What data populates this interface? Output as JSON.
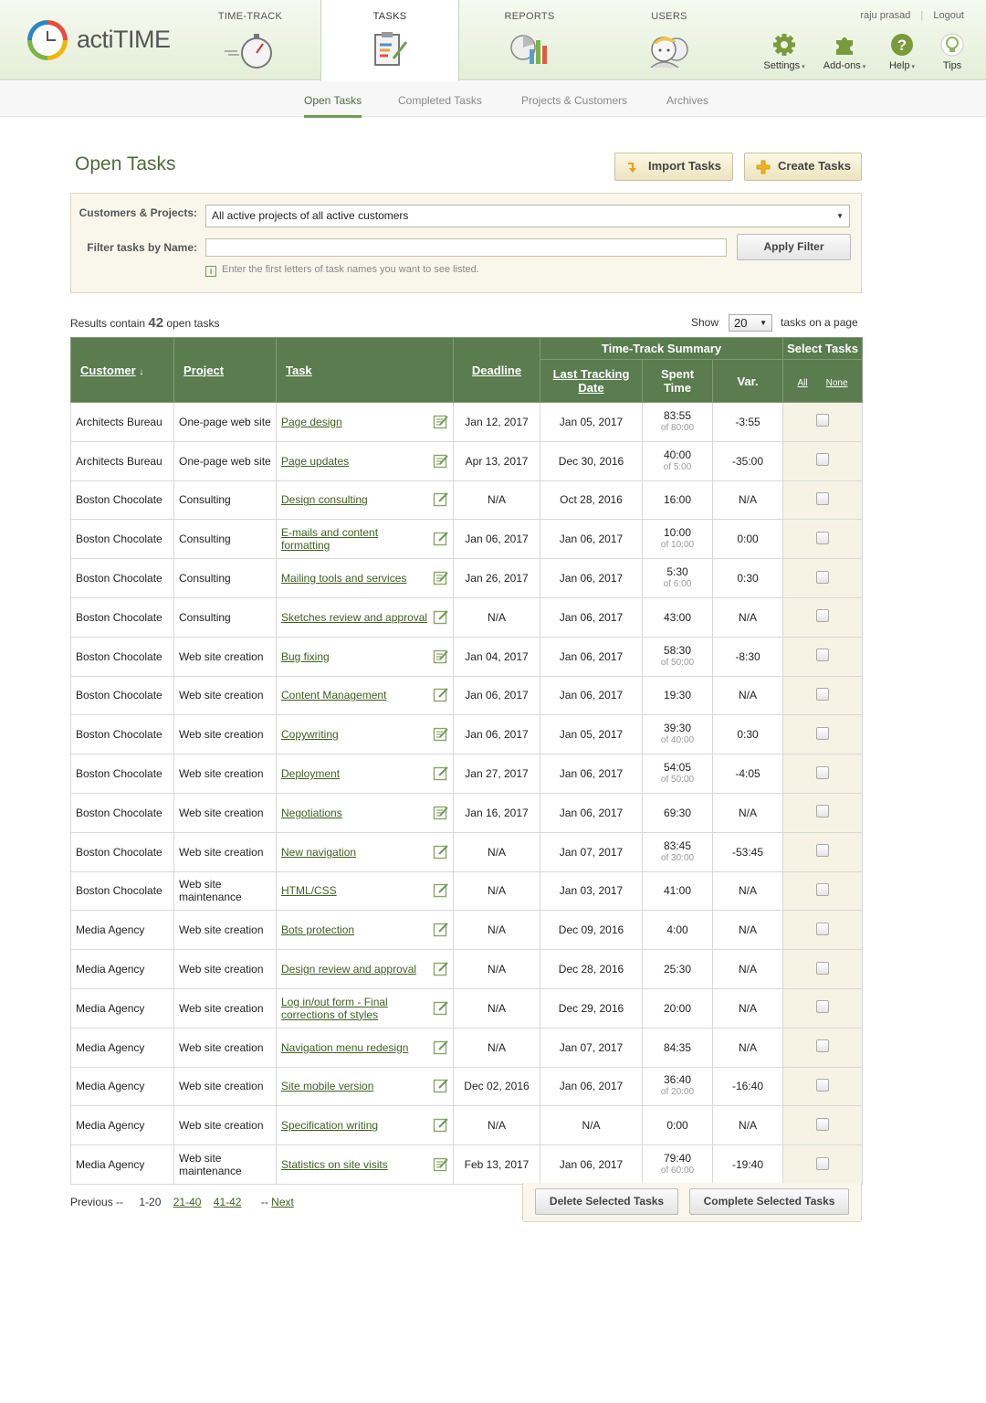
{
  "app": {
    "brand": "actiTIME"
  },
  "nav": {
    "tabs": [
      {
        "label": "TIME-TRACK"
      },
      {
        "label": "TASKS"
      },
      {
        "label": "REPORTS"
      },
      {
        "label": "USERS"
      }
    ],
    "user_name": "raju prasad",
    "logout": "Logout",
    "tools": [
      {
        "label": "Settings",
        "icon": "gear-icon"
      },
      {
        "label": "Add-ons",
        "icon": "puzzle-icon"
      },
      {
        "label": "Help",
        "icon": "help-icon"
      },
      {
        "label": "Tips",
        "icon": "lightbulb-icon"
      }
    ]
  },
  "subnav": {
    "tabs": [
      {
        "label": "Open Tasks",
        "active": true
      },
      {
        "label": "Completed Tasks"
      },
      {
        "label": "Projects & Customers"
      },
      {
        "label": "Archives"
      }
    ]
  },
  "page": {
    "title": "Open Tasks",
    "import_label": "Import Tasks",
    "create_label": "Create Tasks"
  },
  "filter": {
    "customers_label": "Customers & Projects:",
    "customers_value": "All active projects of all active customers",
    "name_label": "Filter tasks by Name:",
    "name_value": "",
    "apply_label": "Apply Filter",
    "hint": "Enter the first letters of task names you want to see listed."
  },
  "results": {
    "prefix": "Results contain",
    "count": "42",
    "suffix": "open tasks",
    "show_label": "Show",
    "page_size": "20",
    "page_suffix": "tasks on a page"
  },
  "table": {
    "headers": {
      "customer": "Customer",
      "project": "Project",
      "task": "Task",
      "deadline": "Deadline",
      "summary": "Time-Track Summary",
      "last_tracking": "Last Tracking Date",
      "spent": "Spent Time",
      "var": "Var.",
      "select": "Select Tasks",
      "all": "All",
      "none": "None"
    },
    "rows": [
      {
        "customer": "Architects Bureau",
        "project": "One-page web site",
        "task": "Page design",
        "deadline": "Jan 12, 2017",
        "deadline_red": false,
        "last": "Jan 05, 2017",
        "spent": "83:55",
        "of": "of 80:00",
        "var": "-3:55",
        "var_style": "red",
        "icon": "notes"
      },
      {
        "customer": "Architects Bureau",
        "project": "One-page web site",
        "task": "Page updates",
        "deadline": "Apr 13, 2017",
        "deadline_red": false,
        "last": "Dec 30, 2016",
        "spent": "40:00",
        "of": "of 5:00",
        "var": "-35:00",
        "var_style": "red",
        "icon": "notes"
      },
      {
        "customer": "Boston Chocolate",
        "project": "Consulting",
        "task": "Design consulting",
        "deadline": "N/A",
        "deadline_red": false,
        "last": "Oct 28, 2016",
        "spent": "16:00",
        "of": "",
        "var": "N/A",
        "var_style": "",
        "icon": "edit"
      },
      {
        "customer": "Boston Chocolate",
        "project": "Consulting",
        "task": "E-mails and content formatting",
        "deadline": "Jan 06, 2017",
        "deadline_red": true,
        "last": "Jan 06, 2017",
        "spent": "10:00",
        "of": "of 10:00",
        "var": "0:00",
        "var_style": "grey",
        "icon": "edit"
      },
      {
        "customer": "Boston Chocolate",
        "project": "Consulting",
        "task": "Mailing tools and services",
        "deadline": "Jan 26, 2017",
        "deadline_red": false,
        "last": "Jan 06, 2017",
        "spent": "5:30",
        "of": "of 6:00",
        "var": "0:30",
        "var_style": "",
        "icon": "notes"
      },
      {
        "customer": "Boston Chocolate",
        "project": "Consulting",
        "task": "Sketches review and approval",
        "deadline": "N/A",
        "deadline_red": false,
        "last": "Jan 06, 2017",
        "spent": "43:00",
        "of": "",
        "var": "N/A",
        "var_style": "",
        "icon": "edit"
      },
      {
        "customer": "Boston Chocolate",
        "project": "Web site creation",
        "task": "Bug fixing",
        "deadline": "Jan 04, 2017",
        "deadline_red": true,
        "last": "Jan 06, 2017",
        "spent": "58:30",
        "of": "of 50:00",
        "var": "-8:30",
        "var_style": "red",
        "icon": "notes"
      },
      {
        "customer": "Boston Chocolate",
        "project": "Web site creation",
        "task": "Content Management",
        "deadline": "Jan 06, 2017",
        "deadline_red": true,
        "last": "Jan 06, 2017",
        "spent": "19:30",
        "of": "",
        "var": "N/A",
        "var_style": "",
        "icon": "edit"
      },
      {
        "customer": "Boston Chocolate",
        "project": "Web site creation",
        "task": "Copywriting",
        "deadline": "Jan 06, 2017",
        "deadline_red": true,
        "last": "Jan 05, 2017",
        "spent": "39:30",
        "of": "of 40:00",
        "var": "0:30",
        "var_style": "",
        "icon": "notes"
      },
      {
        "customer": "Boston Chocolate",
        "project": "Web site creation",
        "task": "Deployment",
        "deadline": "Jan 27, 2017",
        "deadline_red": false,
        "last": "Jan 06, 2017",
        "spent": "54:05",
        "of": "of 50:00",
        "var": "-4:05",
        "var_style": "red",
        "icon": "edit"
      },
      {
        "customer": "Boston Chocolate",
        "project": "Web site creation",
        "task": "Negotiations",
        "deadline": "Jan 16, 2017",
        "deadline_red": false,
        "last": "Jan 06, 2017",
        "spent": "69:30",
        "of": "",
        "var": "N/A",
        "var_style": "",
        "icon": "notes"
      },
      {
        "customer": "Boston Chocolate",
        "project": "Web site creation",
        "task": "New navigation",
        "deadline": "N/A",
        "deadline_red": false,
        "last": "Jan 07, 2017",
        "spent": "83:45",
        "of": "of 30:00",
        "var": "-53:45",
        "var_style": "red",
        "icon": "edit"
      },
      {
        "customer": "Boston Chocolate",
        "project": "Web site maintenance",
        "task": "HTML/CSS",
        "deadline": "N/A",
        "deadline_red": false,
        "last": "Jan 03, 2017",
        "spent": "41:00",
        "of": "",
        "var": "N/A",
        "var_style": "",
        "icon": "edit"
      },
      {
        "customer": "Media Agency",
        "project": "Web site creation",
        "task": "Bots protection",
        "deadline": "N/A",
        "deadline_red": false,
        "last": "Dec 09, 2016",
        "spent": "4:00",
        "of": "",
        "var": "N/A",
        "var_style": "",
        "icon": "edit"
      },
      {
        "customer": "Media Agency",
        "project": "Web site creation",
        "task": "Design review and approval",
        "deadline": "N/A",
        "deadline_red": false,
        "last": "Dec 28, 2016",
        "spent": "25:30",
        "of": "",
        "var": "N/A",
        "var_style": "",
        "icon": "edit"
      },
      {
        "customer": "Media Agency",
        "project": "Web site creation",
        "task": "Log in/out form - Final corrections of styles",
        "deadline": "N/A",
        "deadline_red": false,
        "last": "Dec 29, 2016",
        "spent": "20:00",
        "of": "",
        "var": "N/A",
        "var_style": "",
        "icon": "edit"
      },
      {
        "customer": "Media Agency",
        "project": "Web site creation",
        "task": "Navigation menu redesign",
        "deadline": "N/A",
        "deadline_red": false,
        "last": "Jan 07, 2017",
        "spent": "84:35",
        "of": "",
        "var": "N/A",
        "var_style": "",
        "icon": "edit"
      },
      {
        "customer": "Media Agency",
        "project": "Web site creation",
        "task": "Site mobile version",
        "deadline": "Dec 02, 2016",
        "deadline_red": true,
        "last": "Jan 06, 2017",
        "spent": "36:40",
        "of": "of 20:00",
        "var": "-16:40",
        "var_style": "red",
        "icon": "edit"
      },
      {
        "customer": "Media Agency",
        "project": "Web site creation",
        "task": "Specification writing",
        "deadline": "N/A",
        "deadline_red": false,
        "last": "N/A",
        "spent": "0:00",
        "of": "",
        "var": "N/A",
        "var_style": "",
        "icon": "edit"
      },
      {
        "customer": "Media Agency",
        "project": "Web site maintenance",
        "task": "Statistics on site visits",
        "deadline": "Feb 13, 2017",
        "deadline_red": false,
        "last": "Jan 06, 2017",
        "spent": "79:40",
        "of": "of 60:00",
        "var": "-19:40",
        "var_style": "red",
        "icon": "notes"
      }
    ]
  },
  "pager": {
    "previous": "Previous --",
    "current": "1-20",
    "pages": [
      "21-40",
      "41-42"
    ],
    "next_prefix": "--",
    "next": "Next"
  },
  "actions": {
    "delete_label": "Delete Selected Tasks",
    "complete_label": "Complete Selected Tasks"
  },
  "colors": {
    "header_green": "#5a7c4f",
    "link_green": "#3f5f20",
    "overdue_red": "#e02020"
  }
}
